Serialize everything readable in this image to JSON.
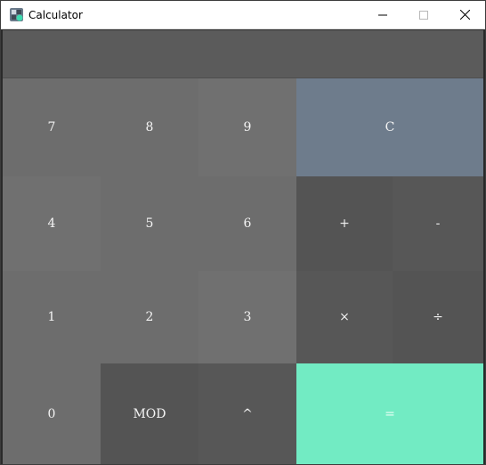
{
  "window": {
    "title": "Calculator"
  },
  "display": {
    "value": ""
  },
  "keypad": {
    "digits": {
      "seven": "7",
      "eight": "8",
      "nine": "9",
      "four": "4",
      "five": "5",
      "six": "6",
      "one": "1",
      "two": "2",
      "three": "3",
      "zero": "0"
    },
    "operators": {
      "clear": "C",
      "plus": "+",
      "minus": "-",
      "multiply": "×",
      "divide": "÷",
      "mod": "MOD",
      "power": "^",
      "equals": "="
    }
  },
  "colors": {
    "display_bg": "#5b5b5b",
    "digit_key": "#6d6d6d",
    "operator_key": "#545454",
    "clear_key": "#6e7c8c",
    "equals_key": "#72ebc3"
  }
}
